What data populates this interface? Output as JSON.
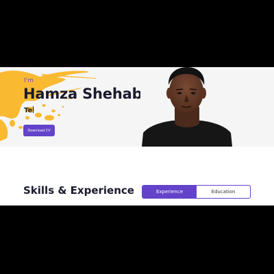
{
  "hero": {
    "greeting": "I'm",
    "name": "Hamza Shehabu",
    "role_typed": "Te",
    "download_label": "Download CV"
  },
  "skills": {
    "title": "Skills & Experience",
    "tabs": [
      {
        "label": "Experience",
        "active": true
      },
      {
        "label": "Education",
        "active": false
      }
    ]
  },
  "colors": {
    "accent": "#6243c9",
    "splash": "#f9b931",
    "hero_bg": "#f5f5f5",
    "frame": "#000000"
  },
  "icons": [
    "paint-splash-decoration",
    "profile-photo"
  ]
}
